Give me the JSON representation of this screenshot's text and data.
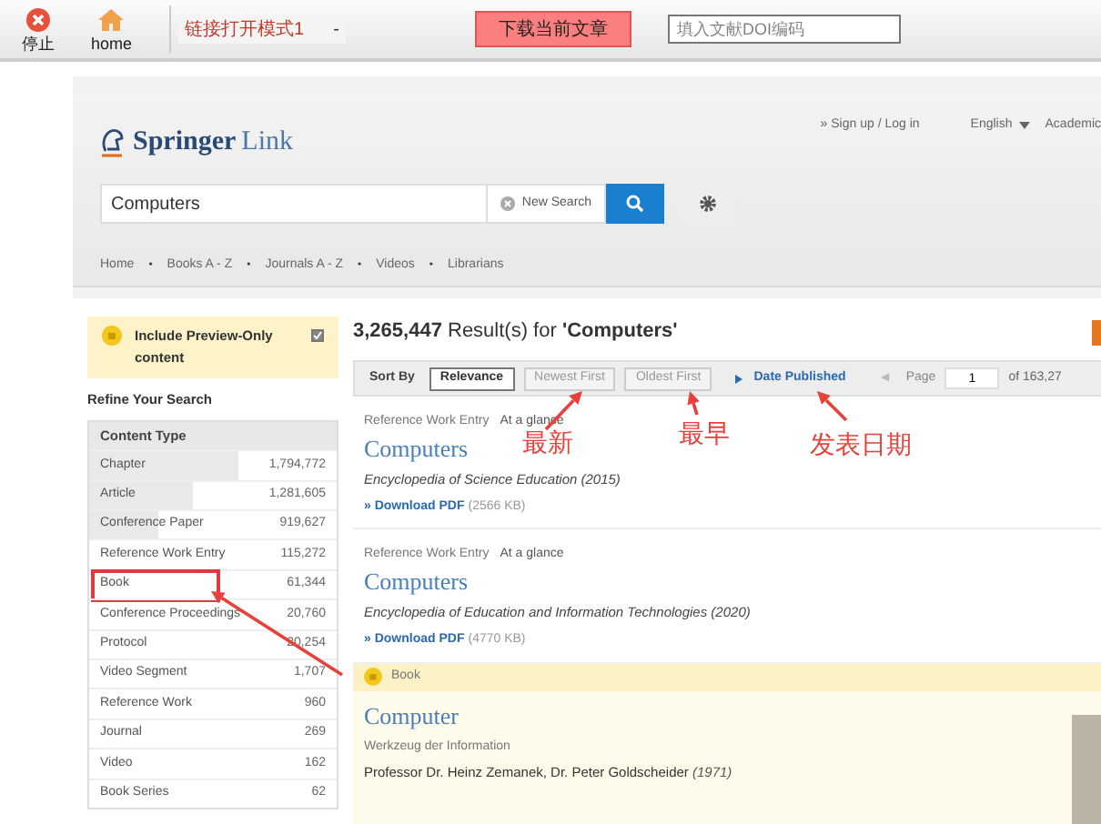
{
  "toolbar": {
    "buttons": [
      {
        "label": "停止"
      },
      {
        "label": "home"
      }
    ],
    "mode_select": {
      "value": "链接打开模式1",
      "caret": "-"
    },
    "download_button": "下载当前文章",
    "id_field": {
      "placeholder": "填入文献DOI编码"
    }
  },
  "header": {
    "logo": {
      "brand": "Springer",
      "product": "Link"
    },
    "account_link": "» Sign up / Log in",
    "language": "English",
    "cut_link": "Academic"
  },
  "search": {
    "value": "Computers",
    "new_search": "New Search"
  },
  "breadcrumbs": [
    {
      "kind": "link",
      "text": "Home"
    },
    {
      "kind": "separator",
      "text": "•"
    },
    {
      "kind": "link",
      "text": "Books A - Z"
    },
    {
      "kind": "separator",
      "text": "•"
    },
    {
      "kind": "link",
      "text": "Journals A - Z"
    },
    {
      "kind": "separator",
      "text": "•"
    },
    {
      "kind": "link",
      "text": "Videos"
    },
    {
      "kind": "separator",
      "text": "•"
    },
    {
      "kind": "link",
      "text": "Librarians"
    }
  ],
  "sidebar": {
    "preview_filter": {
      "label": "Include Preview-Only content",
      "checked": true
    },
    "refine_title": "Refine Your Search",
    "facet": {
      "title": "Content Type",
      "rows": [
        {
          "label": "Chapter",
          "count": "1,794,772",
          "level": 0.6,
          "highlighted": false
        },
        {
          "label": "Article",
          "count": "1,281,605",
          "level": 0.42,
          "highlighted": false
        },
        {
          "label": "Conference Paper",
          "count": "919,627",
          "level": 0.28,
          "highlighted": false
        },
        {
          "label": "Reference Work Entry",
          "count": "115,272",
          "level": 0,
          "highlighted": false
        },
        {
          "label": "Book",
          "count": "61,344",
          "level": 0,
          "highlighted": true
        },
        {
          "label": "Conference Proceedings",
          "count": "20,760",
          "level": 0,
          "highlighted": false
        },
        {
          "label": "Protocol",
          "count": "20,254",
          "level": 0,
          "highlighted": false
        },
        {
          "label": "Video Segment",
          "count": "1,707",
          "level": 0,
          "highlighted": false
        },
        {
          "label": "Reference Work",
          "count": "960",
          "level": 0,
          "highlighted": false
        },
        {
          "label": "Journal",
          "count": "269",
          "level": 0,
          "highlighted": false
        },
        {
          "label": "Video",
          "count": "162",
          "level": 0,
          "highlighted": false
        },
        {
          "label": "Book Series",
          "count": "62",
          "level": 0,
          "highlighted": false
        }
      ]
    }
  },
  "results": {
    "count": "3,265,447",
    "summary": "Result(s) for",
    "query": "'Computers'",
    "sort": {
      "label": "Sort By",
      "options": [
        {
          "label": "Relevance",
          "selected": true
        },
        {
          "label": "Newest First",
          "selected": false
        },
        {
          "label": "Oldest First",
          "selected": false
        }
      ],
      "date_toggle": "Date Published"
    },
    "pagination": {
      "prev": "◀",
      "label": "Page",
      "value": "1",
      "total": "of 163,27"
    },
    "items": [
      {
        "kind": "entry",
        "type": "Reference Work Entry",
        "tag": "At a glance",
        "title": "Computers",
        "source": "Encyclopedia of Science Education (2015)",
        "download": "» Download PDF",
        "size": "(2566 KB)"
      },
      {
        "kind": "entry",
        "type": "Reference Work Entry",
        "tag": "At a glance",
        "title": "Computers",
        "source": "Encyclopedia of Education and Information Technologies (2020)",
        "download": "» Download PDF",
        "size": "(4770 KB)"
      },
      {
        "kind": "book",
        "type": "Book",
        "title": "Computer",
        "subtitle": "Werkzeug der Information",
        "authors": "Professor Dr. Heinz Zemanek, Dr. Peter Goldscheider",
        "year": "(1971)"
      }
    ]
  },
  "annotations": [
    {
      "text": "最新"
    },
    {
      "text": "最早"
    },
    {
      "text": "发表日期"
    }
  ]
}
